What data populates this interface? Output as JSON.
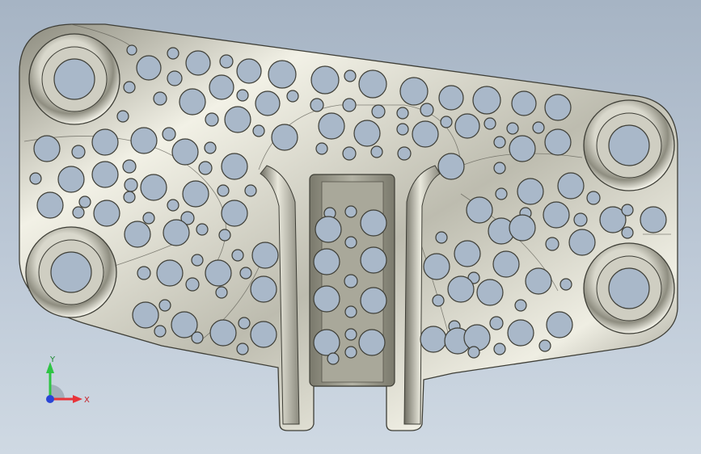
{
  "viewport": {
    "background_top": "#a6b4c4",
    "background_bottom": "#cfd9e3"
  },
  "model": {
    "part_face_color": "#c9c8bb",
    "part_edge_color": "#3e3e36",
    "hole_fill_color": "#a9b8c9"
  },
  "triad": {
    "x_label": "X",
    "y_label": "Y",
    "x_color": "#e8343a",
    "y_color": "#2ec444",
    "z_color": "#2a45d6"
  }
}
